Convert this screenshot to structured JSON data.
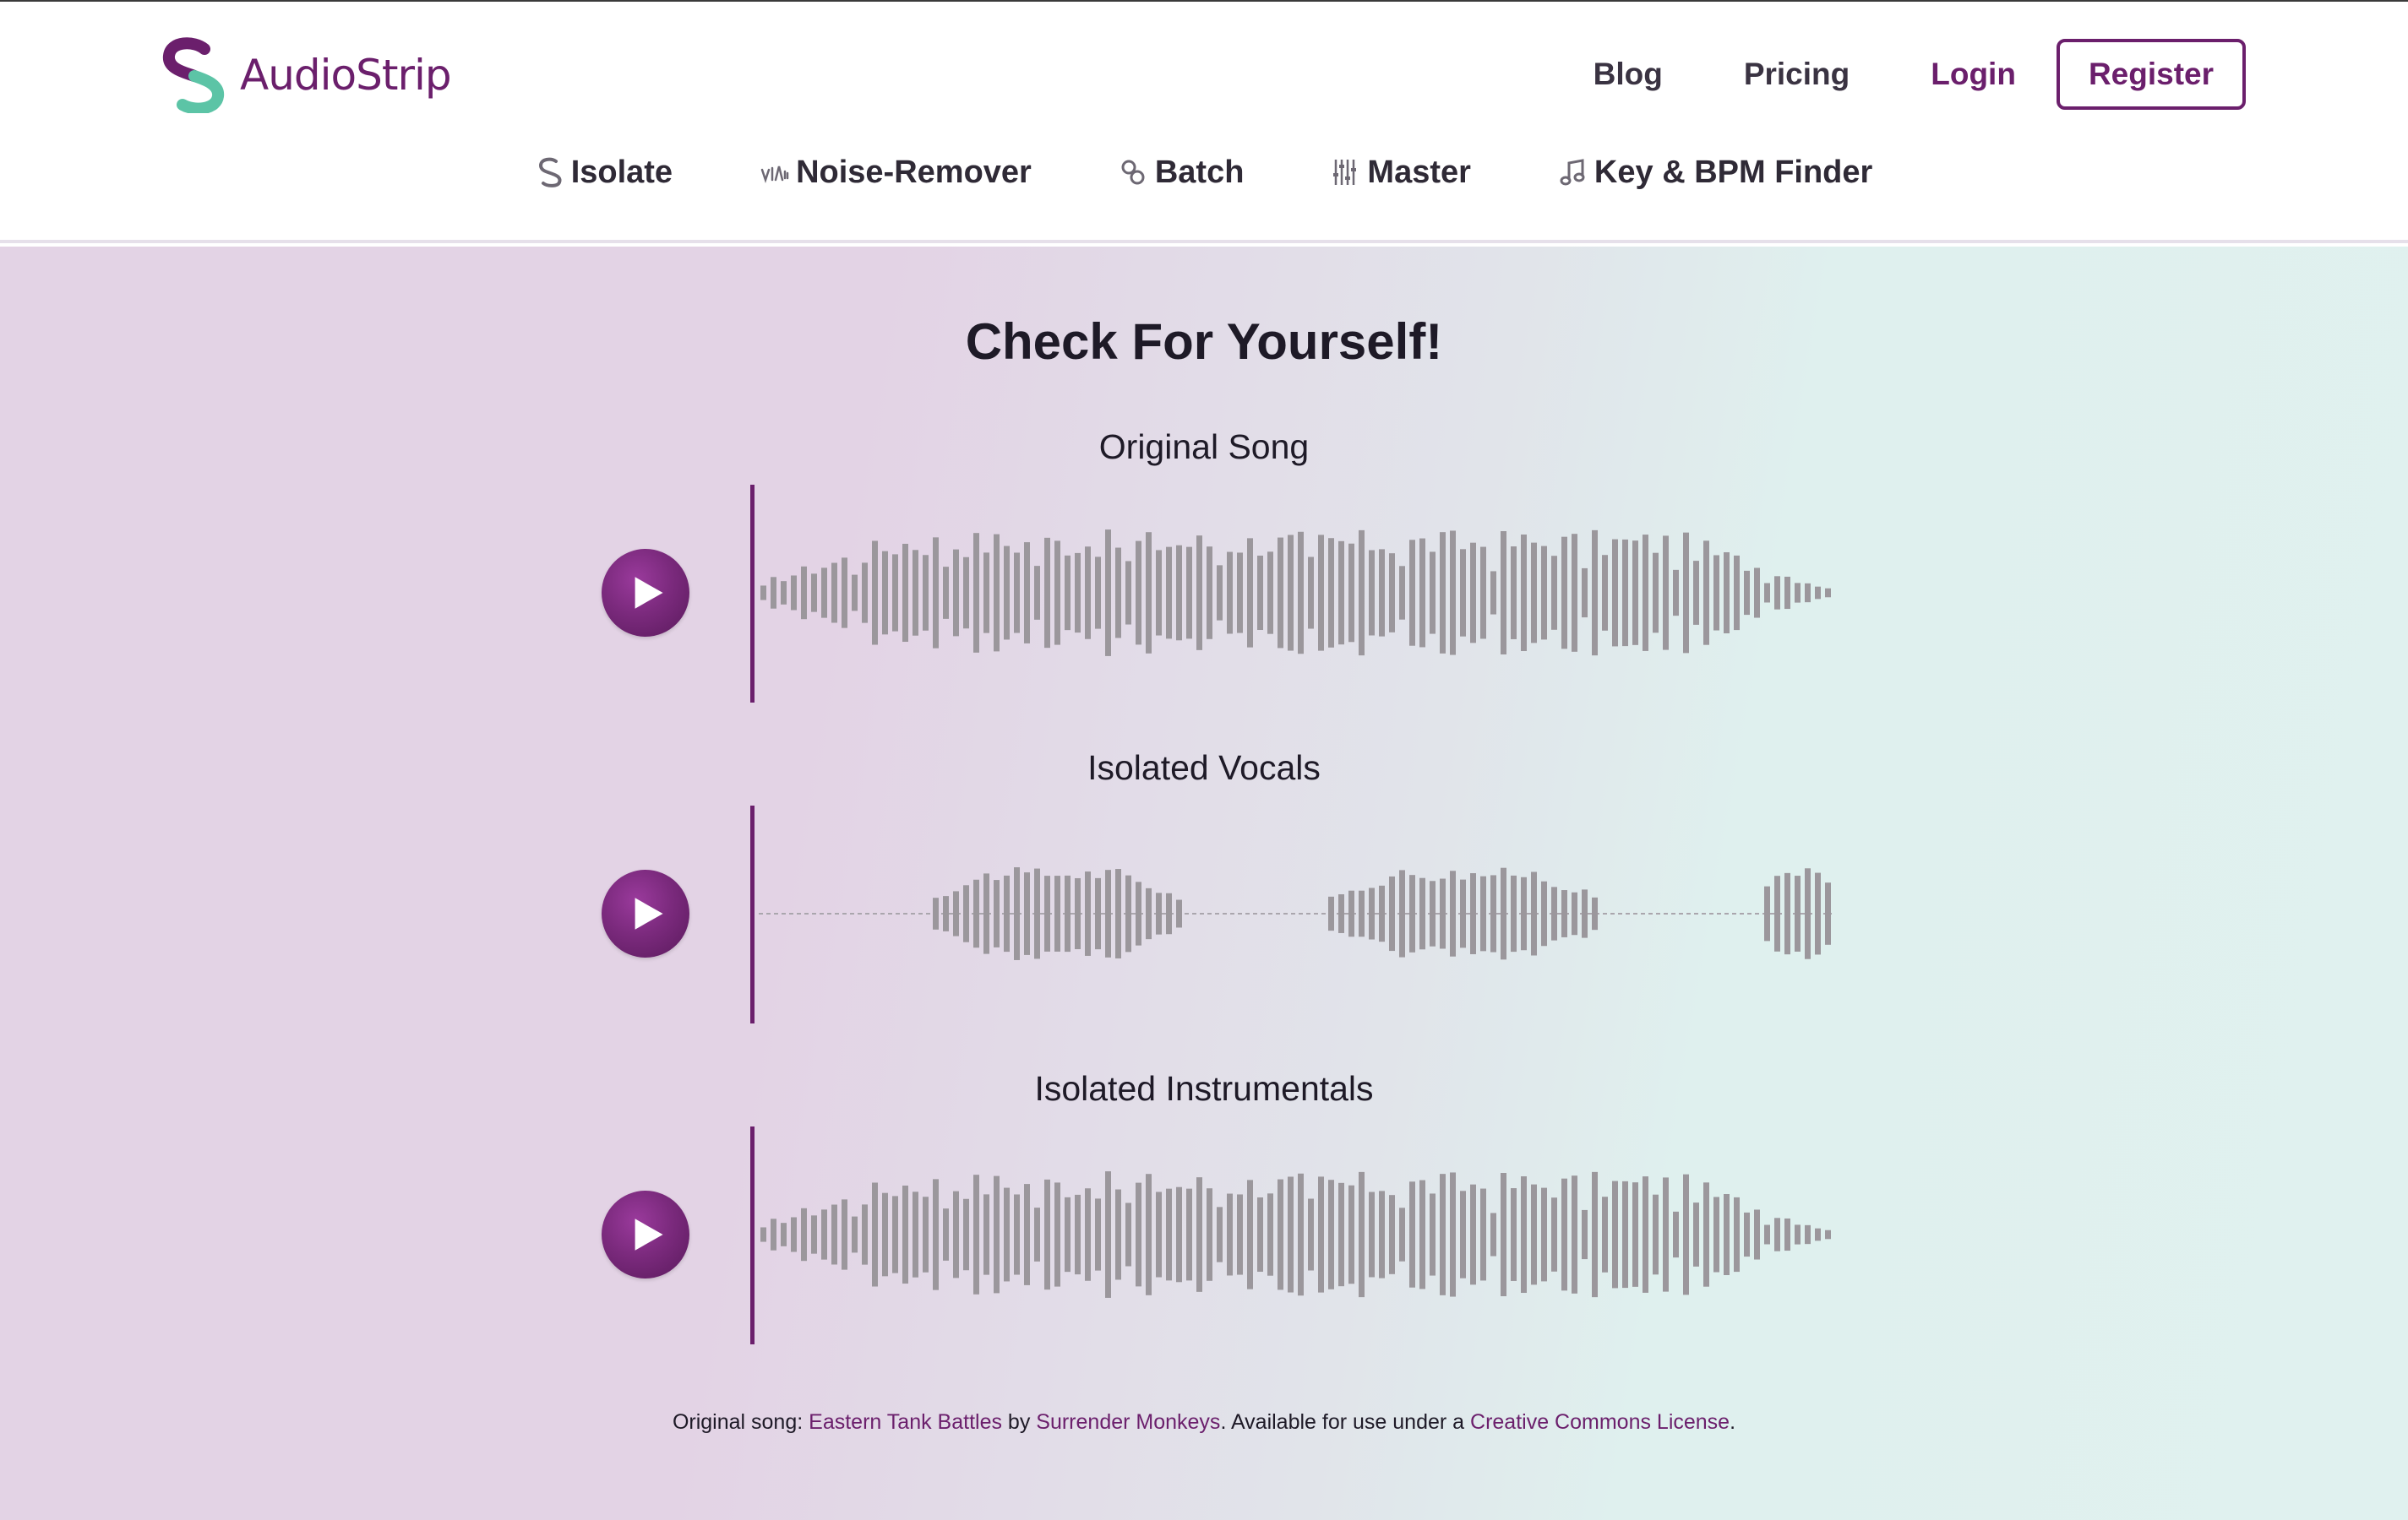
{
  "brand": {
    "name": "AudioStrip",
    "logo_colors": {
      "primary": "#6b1f6c",
      "secondary": "#5cc4a6"
    }
  },
  "top_nav": {
    "links": [
      {
        "label": "Blog"
      },
      {
        "label": "Pricing"
      },
      {
        "label": "Login"
      }
    ],
    "register_label": "Register"
  },
  "tool_nav": [
    {
      "label": "Isolate",
      "icon": "isolate-icon"
    },
    {
      "label": "Noise-Remover",
      "icon": "noise-remover-icon"
    },
    {
      "label": "Batch",
      "icon": "batch-icon"
    },
    {
      "label": "Master",
      "icon": "master-icon"
    },
    {
      "label": "Key & BPM Finder",
      "icon": "music-note-icon"
    }
  ],
  "hero": {
    "title": "Check For Yourself!",
    "tracks": [
      {
        "label": "Original Song",
        "type": "full"
      },
      {
        "label": "Isolated Vocals",
        "type": "vocals"
      },
      {
        "label": "Isolated Instrumentals",
        "type": "full"
      }
    ]
  },
  "credit": {
    "prefix": "Original song: ",
    "song": "Eastern Tank Battles",
    "by": " by ",
    "artist": "Surrender Monkeys",
    "middle": ". Available for use under a ",
    "license": "Creative Commons License",
    "suffix": "."
  },
  "colors": {
    "accent": "#6b1f6c",
    "waveform": "#9b979c",
    "hero_left": "#e3d3e5",
    "hero_right": "#e0f1ef"
  }
}
